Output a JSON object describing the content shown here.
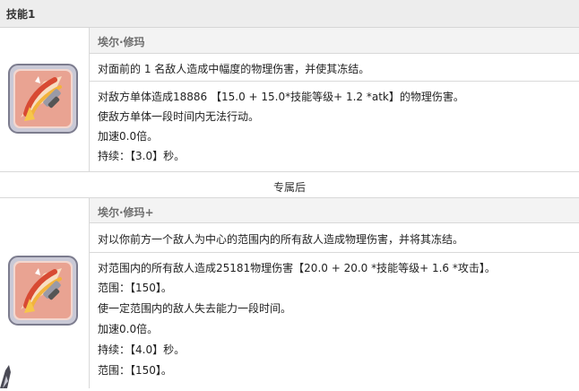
{
  "header": {
    "title": "技能1"
  },
  "skill1": {
    "name": "埃尔·修玛",
    "summary": "对面前的 1 名敌人造成中幅度的物理伤害，并使其冻结。",
    "details": [
      "对敌方单体造成18886 【15.0 + 15.0*技能等级+ 1.2 *atk】的物理伤害。",
      "使敌方单体一段时间内无法行动。",
      "加速0.0倍。",
      "持续：【3.0】秒。"
    ]
  },
  "divider": {
    "label": "专属后"
  },
  "skill2": {
    "name": "埃尔·修玛+",
    "summary": "对以你前方一个敌人为中心的范围内的所有敌人造成物理伤害，并将其冻结。",
    "details": [
      "对范围内的所有敌人造成25181物理伤害【20.0 + 20.0 *技能等级+ 1.6 *攻击】。",
      "范围：【150】。",
      "使一定范围内的敌人失去能力一段时间。",
      "加速0.0倍。",
      "持续：【4.0】秒。",
      "范围：【150】。"
    ]
  },
  "colors": {
    "header_bg": "#ededed",
    "name_row_bg": "#f3f3f3",
    "border": "#d9d9d9",
    "icon_red": "#d84a33",
    "icon_gold": "#f2b33d"
  },
  "icons": {
    "skill_icon": "flaming-sword-icon"
  }
}
